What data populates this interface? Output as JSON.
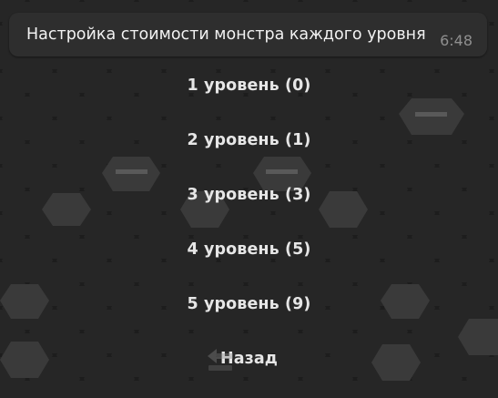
{
  "message": {
    "text": "Настройка стоимости монстра каждого уровня",
    "time": "6:48"
  },
  "keyboard": {
    "buttons": [
      {
        "label": "1 уровень (0)"
      },
      {
        "label": "2 уровень (1)"
      },
      {
        "label": "3 уровень (3)"
      },
      {
        "label": "4 уровень (5)"
      },
      {
        "label": "5 уровень (9)"
      },
      {
        "label": "Назад"
      }
    ]
  },
  "background": {
    "base_color": "#1d1d1d",
    "hex_color": "#262626",
    "hex_highlight": "#3a3a3a"
  },
  "icons": {
    "back_watermark": "back-arrow-icon"
  }
}
